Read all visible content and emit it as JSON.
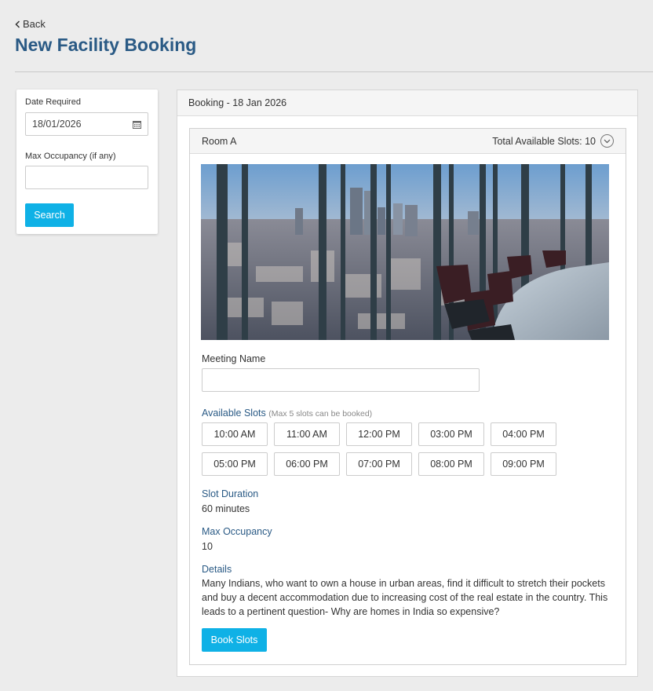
{
  "nav": {
    "back_label": "Back"
  },
  "page": {
    "title": "New Facility Booking"
  },
  "search": {
    "date_label": "Date Required",
    "date_value": "18/01/2026",
    "occupancy_label": "Max Occupancy (if any)",
    "occupancy_value": "",
    "button_label": "Search"
  },
  "booking": {
    "header": "Booking - 18 Jan 2026",
    "room": {
      "name": "Room A",
      "total_slots": "Total Available Slots: 10",
      "meeting_name_label": "Meeting Name",
      "meeting_name_value": "",
      "available_slots_label": "Available Slots",
      "available_slots_note": "(Max 5 slots can be booked)",
      "slots": [
        "10:00 AM",
        "11:00 AM",
        "12:00 PM",
        "03:00 PM",
        "04:00 PM",
        "05:00 PM",
        "06:00 PM",
        "07:00 PM",
        "08:00 PM",
        "09:00 PM"
      ],
      "slot_duration_label": "Slot Duration",
      "slot_duration_value": "60 minutes",
      "max_occupancy_label": "Max Occupancy",
      "max_occupancy_value": "10",
      "details_label": "Details",
      "details_text": "Many Indians, who want to own a house in urban areas, find it difficult to stretch their pockets and buy a decent accommodation due to increasing cost of the real estate in the country. This leads to a pertinent question- Why are homes in India so expensive?",
      "book_button_label": "Book Slots"
    }
  },
  "colors": {
    "accent": "#0fb1e6",
    "title": "#2a5a85",
    "background": "#ececec"
  }
}
